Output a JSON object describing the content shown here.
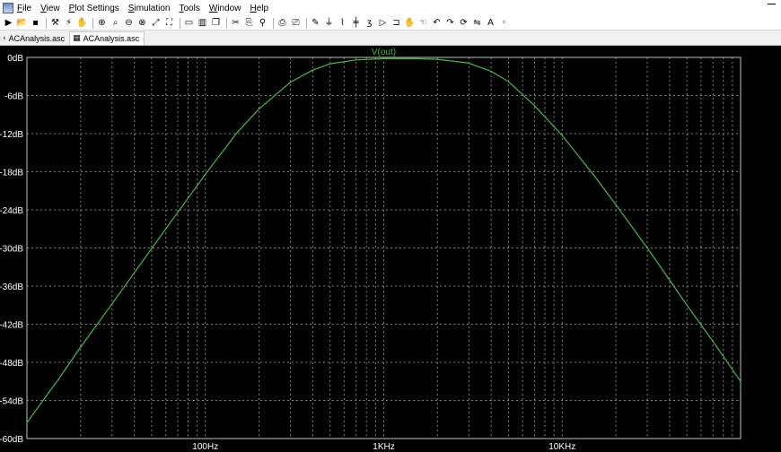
{
  "menu": [
    "File",
    "View",
    "Plot Settings",
    "Simulation",
    "Tools",
    "Window",
    "Help"
  ],
  "toolbar_icons": [
    "run-icon",
    "open-folder-icon",
    "save-icon",
    "control-panel-icon",
    "run-halt-icon",
    "pan-hand-icon",
    "zoom-in-icon",
    "zoom-area-icon",
    "zoom-out-icon",
    "zoom-cancel-icon",
    "autorange-icon",
    "zoom-fit-icon",
    "tile-horizontal-icon",
    "tile-vertical-icon",
    "cascade-icon",
    "cut-icon",
    "copy-icon",
    "find-icon",
    "print-icon",
    "print-preview-icon",
    "draw-wire-icon",
    "ground-icon",
    "resistor-icon",
    "capacitor-icon",
    "inductor-icon",
    "diode-icon",
    "component-icon",
    "move-hand-icon",
    "drag-hand-icon",
    "undo-icon",
    "redo-icon",
    "rotate-icon",
    "mirror-icon",
    "text-icon",
    "spice-directive-icon"
  ],
  "tabs": [
    {
      "label": "ACAnalysis.asc",
      "icon": "back-arrow-icon"
    },
    {
      "label": "ACAnalysis.asc",
      "icon": "schematic-icon"
    }
  ],
  "chart_data": {
    "type": "line",
    "title": "V(out)",
    "x_scale": "log",
    "xlim": [
      10,
      100000
    ],
    "ylim": [
      -60,
      0
    ],
    "y_ticks": [
      0,
      -6,
      -12,
      -18,
      -24,
      -30,
      -36,
      -42,
      -48,
      -54,
      -60
    ],
    "y_tick_labels": [
      "0dB",
      "-6dB",
      "-12dB",
      "-18dB",
      "-24dB",
      "-30dB",
      "-36dB",
      "-42dB",
      "-48dB",
      "-54dB",
      "-60dB"
    ],
    "x_tick_labels": [
      {
        "value": 100,
        "label": "100Hz"
      },
      {
        "value": 1000,
        "label": "1KHz"
      },
      {
        "value": 10000,
        "label": "10KHz"
      }
    ],
    "grid": true,
    "series": [
      {
        "name": "V(out)",
        "color": "#3fbf3f",
        "x": [
          10,
          15,
          20,
          30,
          50,
          70,
          100,
          150,
          200,
          300,
          400,
          500,
          700,
          1000,
          1500,
          2000,
          3000,
          4000,
          5000,
          7000,
          10000,
          15000,
          20000,
          30000,
          50000,
          70000,
          100000
        ],
        "y": [
          -57.5,
          -50.7,
          -45.6,
          -38.8,
          -30.1,
          -24.4,
          -18.4,
          -11.9,
          -8.1,
          -3.9,
          -2.0,
          -1.0,
          -0.4,
          -0.2,
          -0.2,
          -0.3,
          -0.9,
          -2.2,
          -3.8,
          -7.6,
          -12.3,
          -18.5,
          -23.2,
          -30.0,
          -39.0,
          -44.7,
          -51.0
        ]
      }
    ]
  }
}
